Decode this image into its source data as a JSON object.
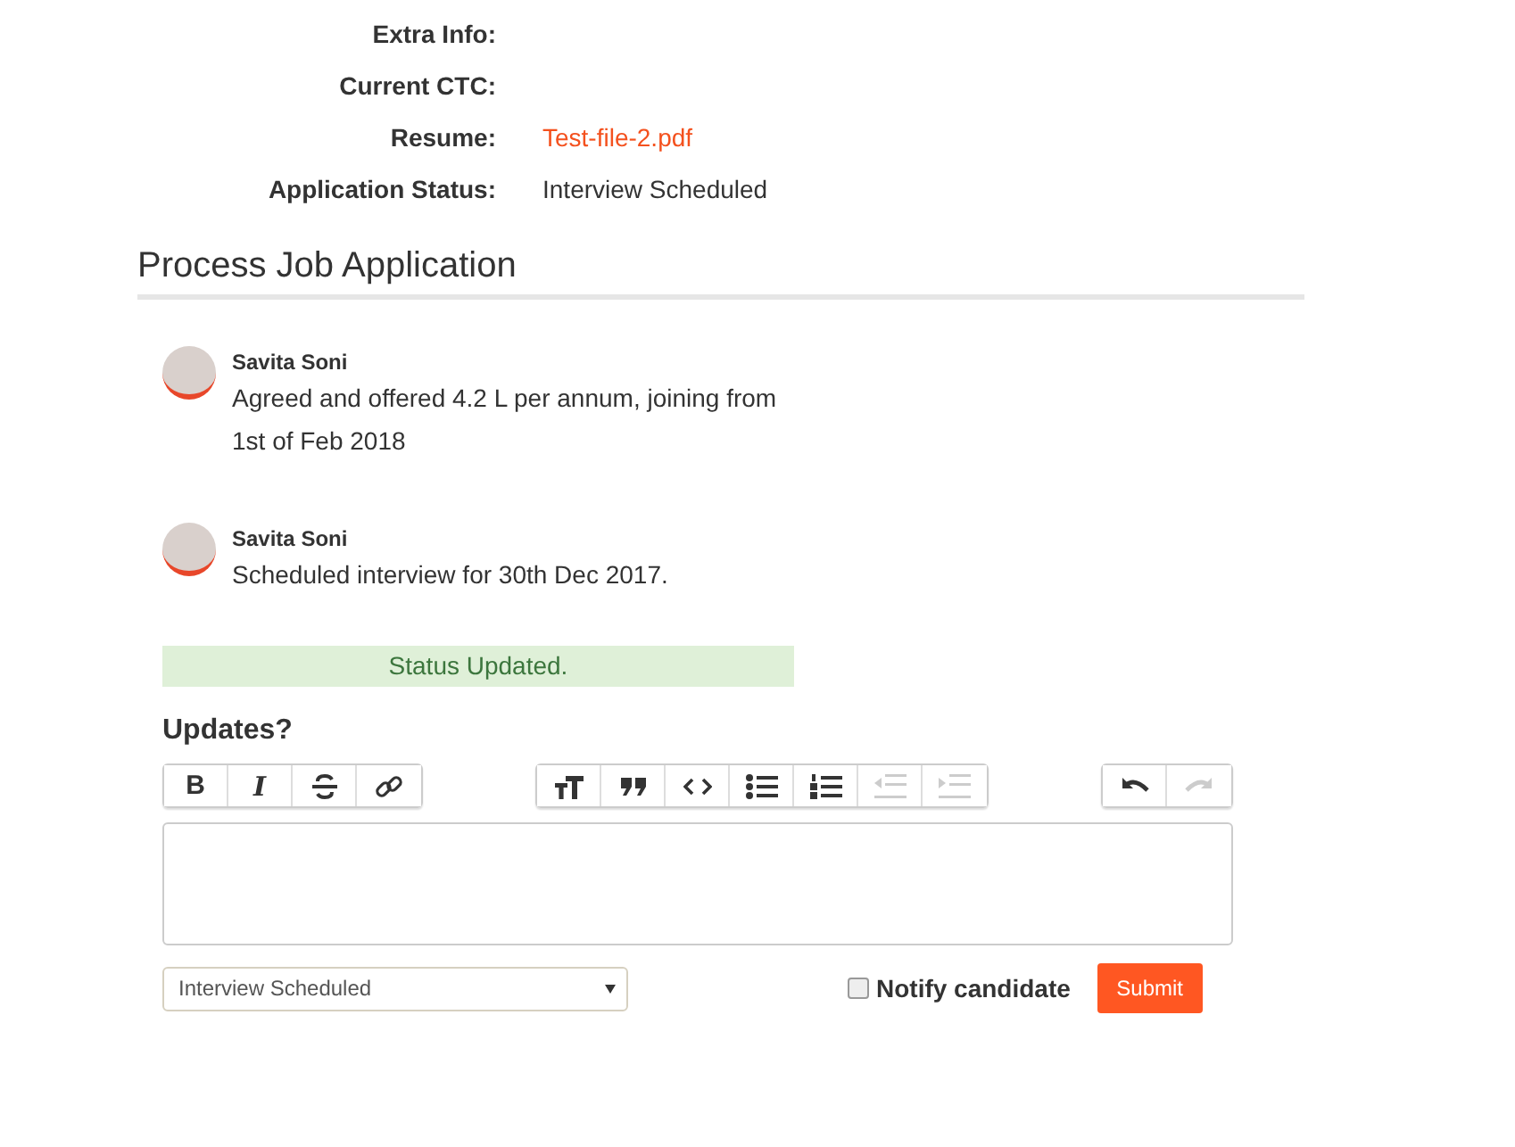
{
  "details": [
    {
      "label": "Extra Info:"
    },
    {
      "label": "Current CTC:"
    },
    {
      "label": "Resume:",
      "value": "Test-file-2.pdf",
      "kind": "link"
    },
    {
      "label": "Application Status:",
      "value": "Interview Scheduled",
      "kind": "text"
    }
  ],
  "section_title": "Process Job Application",
  "comments": [
    {
      "author": "Savita Soni",
      "text": "Agreed and offered 4.2 L per annum, joining from 1st of Feb 2018"
    },
    {
      "author": "Savita Soni",
      "text": "Scheduled interview for 30th Dec 2017."
    }
  ],
  "alert": "Status Updated.",
  "updates_label": "Updates?",
  "toolbar": [
    [
      {
        "kind": "bold",
        "label": "B",
        "disabled": false
      },
      {
        "kind": "italic",
        "label": "I",
        "disabled": false
      },
      {
        "kind": "strike",
        "disabled": false
      },
      {
        "kind": "link",
        "disabled": false
      }
    ],
    [
      {
        "kind": "heading",
        "disabled": false
      },
      {
        "kind": "quote",
        "disabled": false
      },
      {
        "kind": "code",
        "disabled": false
      },
      {
        "kind": "ul",
        "disabled": false
      },
      {
        "kind": "ol",
        "disabled": false
      },
      {
        "kind": "outdent",
        "disabled": true
      },
      {
        "kind": "indent",
        "disabled": true
      }
    ],
    [
      {
        "kind": "undo",
        "disabled": false
      },
      {
        "kind": "redo",
        "disabled": true
      }
    ]
  ],
  "status_select": {
    "value": "Interview Scheduled"
  },
  "notify": {
    "label": "Notify candidate",
    "checked": false
  },
  "submit": "Submit"
}
